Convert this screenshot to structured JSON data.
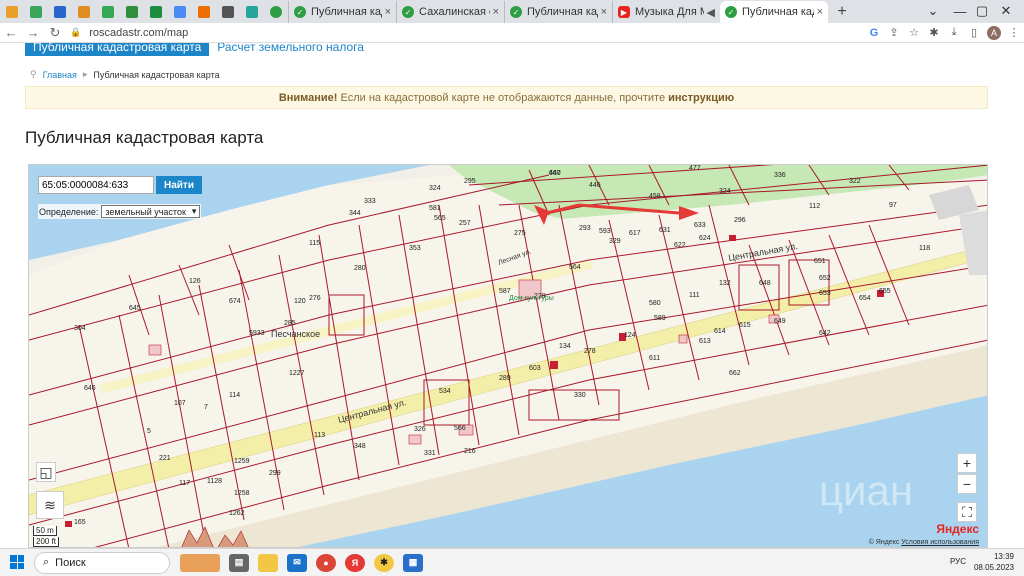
{
  "browser": {
    "tabs": [
      {
        "title": "Публичная кадастр",
        "favicon_color": "#2e9e44",
        "active": false
      },
      {
        "title": "Сахалинская облас",
        "favicon_color": "#2e9e44",
        "active": false
      },
      {
        "title": "Публичная кадастр",
        "favicon_color": "#2e9e44",
        "active": false
      },
      {
        "title": "Музыка Для М...",
        "favicon_color": "#e52620",
        "active": false
      },
      {
        "title": "Публичная кадастр",
        "favicon_color": "#2e9e44",
        "active": true
      }
    ],
    "new_tab_label": "+",
    "close_label": "×",
    "url": "roscadastr.com/map",
    "profile_letter": "A"
  },
  "page": {
    "nav_button": "Публичная кадастровая карта",
    "nav_link": "Расчет земельного налога",
    "breadcrumb_home": "Главная",
    "breadcrumb_current": "Публичная кадастровая карта",
    "alert_strong": "Внимание!",
    "alert_text": " Если на кадастровой карте не отображаются данные, прочтите ",
    "alert_link": "инструкцию",
    "title": "Публичная кадастровая карта"
  },
  "map": {
    "search_value": "65:05:0000084:633",
    "search_button": "Найти",
    "definition_label": "Определение:",
    "definition_value": "земельный участок",
    "zoom_in": "+",
    "zoom_out": "−",
    "scale_m": "50 m",
    "scale_ft": "200 ft",
    "yandex_prefix": "Я",
    "yandex_rest": "ндекс",
    "copyright": "© Яндекс",
    "terms": "Условия использования",
    "street_central_1": "Центральная ул.",
    "street_central_2": "Центральная ул.",
    "street_lesnaya": "Лесная ул.",
    "village": "Песчанское",
    "culture_house": "Дом культуры",
    "watermark": "циан",
    "parcels": [
      "467",
      "446",
      "458",
      "477",
      "336",
      "322",
      "324",
      "296",
      "112",
      "97",
      "633",
      "631",
      "624",
      "622",
      "593",
      "329",
      "617",
      "118",
      "651",
      "652",
      "653",
      "654",
      "655",
      "648",
      "649",
      "642",
      "132",
      "111",
      "615",
      "614",
      "613",
      "611",
      "589",
      "580",
      "124",
      "662",
      "564",
      "275",
      "587",
      "279",
      "293",
      "295",
      "324",
      "581",
      "565",
      "257",
      "353",
      "344",
      "333",
      "115",
      "126",
      "120",
      "674",
      "5933",
      "285",
      "276",
      "280",
      "304",
      "645",
      "646",
      "534",
      "330",
      "289",
      "603",
      "134",
      "278",
      "348",
      "299",
      "1262",
      "1227",
      "114",
      "107",
      "7",
      "5",
      "221",
      "165",
      "216",
      "331",
      "326",
      "566",
      "113",
      "117",
      "1128",
      "1258",
      "1259",
      "640"
    ]
  },
  "taskbar": {
    "search": "Поиск",
    "lang": "РУС",
    "time": "13:39",
    "date": "08.05.2023"
  },
  "colors": {
    "accent": "#1d86c9",
    "water": "#a9d3ee",
    "green": "#b9e3a7",
    "road": "#f4efa8",
    "parcel_line": "#a8182a",
    "arrow": "#e53935"
  }
}
